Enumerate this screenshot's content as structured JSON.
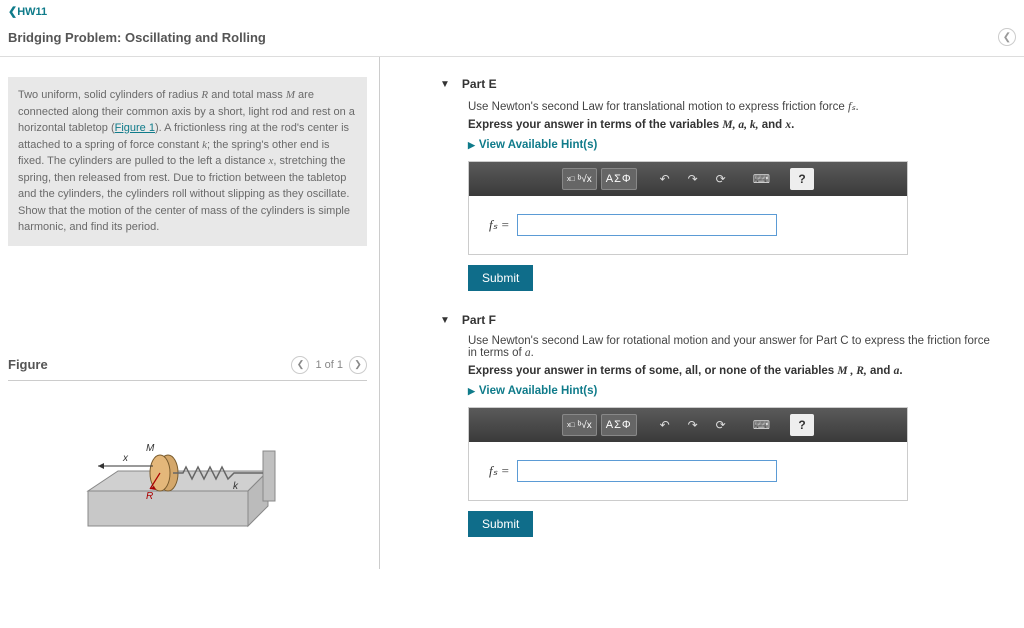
{
  "nav": {
    "back": "❮HW11"
  },
  "header": {
    "title": "Bridging Problem: Oscillating and Rolling"
  },
  "problem": {
    "text_pre": "Two uniform, solid cylinders of radius ",
    "var_R": "R",
    "text_mid1": " and total mass ",
    "var_M": "M",
    "text_mid2": " are connected along their common axis by a short, light rod and rest on a horizontal tabletop (",
    "figure_link": "Figure 1",
    "text_mid3": "). A frictionless ring at the rod's center is attached to a spring of force constant ",
    "var_k": "k",
    "text_mid4": "; the spring's other end is fixed. The cylinders are pulled to the left a distance ",
    "var_x": "x",
    "text_end": ", stretching the spring, then released from rest. Due to friction between the tabletop and the cylinders, the cylinders roll without slipping as they oscillate. Show that the motion of the center of mass of the cylinders is simple harmonic, and find its period."
  },
  "figure": {
    "title": "Figure",
    "counter": "1 of 1"
  },
  "parts": {
    "e": {
      "title": "Part E",
      "instruction_pre": "Use Newton's second Law for translational motion to express friction force ",
      "instruction_var": "fₛ",
      "instruction_post": ".",
      "express_pre": "Express your answer in terms of the variables ",
      "express_vars": "M, a, k,",
      "express_post": " and ",
      "express_last": "x",
      "express_end": ".",
      "hints": "View Available Hint(s)",
      "label": "fₛ =",
      "submit": "Submit"
    },
    "f": {
      "title": "Part F",
      "instruction_pre": "Use Newton's second Law for rotational motion and your answer for Part C to express the friction force in terms of ",
      "instruction_var": "a",
      "instruction_post": ".",
      "express_pre": "Express your answer in terms of some, all, or none of the variables ",
      "express_vars": "M , R,",
      "express_post": " and ",
      "express_last": "a",
      "express_end": ".",
      "hints": "View Available Hint(s)",
      "label": "fₛ =",
      "submit": "Submit"
    }
  },
  "toolbar": {
    "template": "√x",
    "greek": "ΑΣΦ",
    "undo": "↶",
    "redo": "↷",
    "reset": "⟳",
    "keyboard": "⌨",
    "help": "?"
  }
}
